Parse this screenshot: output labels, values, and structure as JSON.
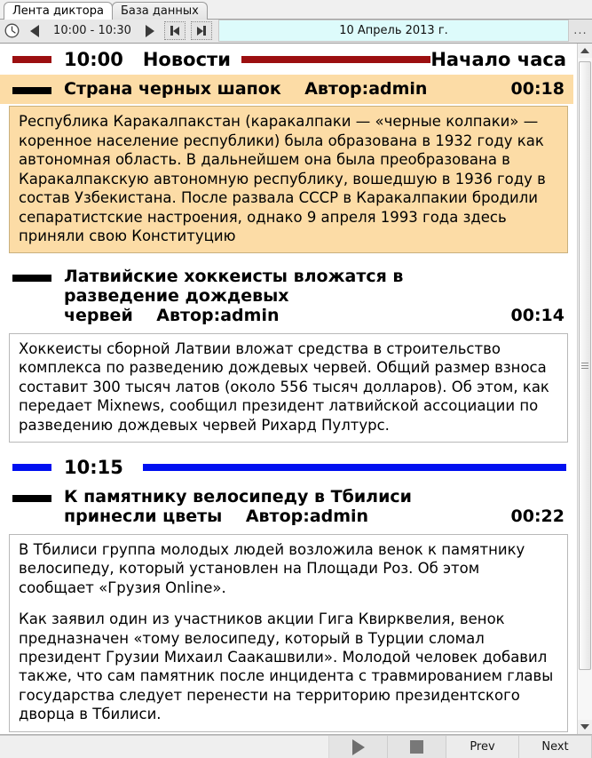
{
  "tabs": [
    {
      "label": "Лента диктора",
      "active": true
    },
    {
      "label": "База данных",
      "active": false
    }
  ],
  "toolbar": {
    "clock_icon": "clock-icon",
    "prev_icon": "triangle-left-icon",
    "time_range": "10:00 - 10:30",
    "next_icon": "triangle-right-icon",
    "skip_start_icon": "skip-to-start-icon",
    "skip_end_icon": "skip-to-end-icon",
    "date_value": "10 Апрель 2013 г.",
    "more_label": "..."
  },
  "feed": {
    "blocks": [
      {
        "type": "hour",
        "dash_color": "#9c0f10",
        "time": "10:00",
        "label": "Новости",
        "tail": "Начало часа"
      },
      {
        "type": "item",
        "selected": true,
        "title": "Страна черных шапок",
        "author": "Автор:admin",
        "duration": "00:18",
        "paragraphs": [
          "Республика Каракалпакстан (каракалпаки — «черные колпаки» — коренное население республики) была образована в 1932 году как автономная область. В дальнейшем она была преобразована в Каракалпакскую автономную республику, вошедшую в 1936 году в состав Узбекистана. После развала СССР в Каракалпакии бродили сепаратистские настроения, однако 9 апреля 1993 года здесь приняли свою Конституцию"
        ]
      },
      {
        "type": "item",
        "selected": false,
        "title": "Латвийские хоккеисты вложатся в разведение дождевых червей",
        "author": "Автор:admin",
        "duration": "00:14",
        "paragraphs": [
          "Хоккеисты сборной Латвии вложат средства в строительство комплекса по разведению дождевых червей. Общий размер взноса составит 300 тысяч латов (около 556 тысяч долларов). Об этом, как передает Mixnews, сообщил президент латвийской ассоциации по разведению дождевых червей Рихард Пултурс."
        ]
      },
      {
        "type": "hour",
        "dash_color": "#0010f0",
        "time": "10:15",
        "label": "",
        "tail": ""
      },
      {
        "type": "item",
        "selected": false,
        "title": "К памятнику велосипеду в Тбилиси принесли цветы",
        "author": "Автор:admin",
        "duration": "00:22",
        "paragraphs": [
          "В Тбилиси группа молодых людей возложила венок к памятнику велосипеду, который установлен на Площади Роз. Об этом сообщает «Грузия Online».",
          "Как заявил один из участников акции Гига Квирквелия, венок предназначен «тому велосипеду, который в Турции сломал президент Грузии Михаил Саакашвили». Молодой человек добавил также, что сам памятник после инцидента с травмированием главы государства следует перенести на территорию президентского дворца в Тбилиси."
        ]
      }
    ]
  },
  "scrollbar": {
    "up_icon": "scroll-up-arrow-icon",
    "down_icon": "scroll-down-arrow-icon"
  },
  "bottombar": {
    "play_icon": "play-icon",
    "stop_icon": "stop-icon",
    "prev_label": "Prev",
    "next_label": "Next"
  },
  "colors": {
    "hour_red": "#9c0f10",
    "hour_blue": "#0010f0",
    "selected_bg": "#fcdca6",
    "date_bg": "#ddfbfb"
  }
}
